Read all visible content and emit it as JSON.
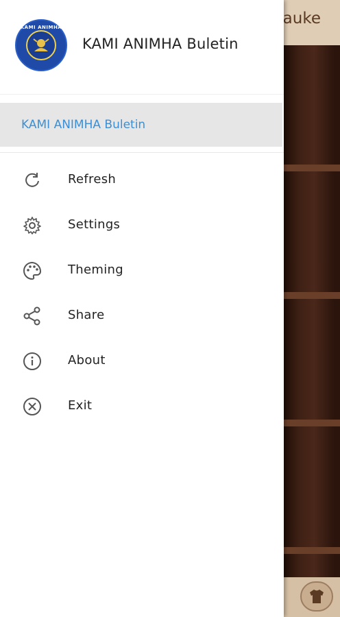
{
  "background_app": {
    "title_fragment": "auke"
  },
  "drawer": {
    "header": {
      "logo_text": "KAMI ANIMHA",
      "title": "KAMI ANIMHA Buletin"
    },
    "selected_item": {
      "label": "KAMI ANIMHA Buletin"
    },
    "menu": [
      {
        "label": "Refresh",
        "icon": "refresh-icon"
      },
      {
        "label": "Settings",
        "icon": "gear-icon"
      },
      {
        "label": "Theming",
        "icon": "palette-icon"
      },
      {
        "label": "Share",
        "icon": "share-icon"
      },
      {
        "label": "About",
        "icon": "info-icon"
      },
      {
        "label": "Exit",
        "icon": "close-circle-icon"
      }
    ]
  },
  "colors": {
    "accent": "#3a8fd6",
    "selected_bg": "#e6e6e6",
    "text": "#222222"
  }
}
